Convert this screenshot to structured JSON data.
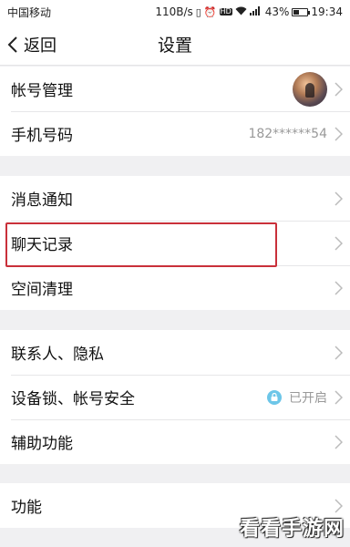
{
  "status_bar": {
    "carrier": "中国移动",
    "speed": "110B/s",
    "signal_label": "4G",
    "battery_percent": "43%",
    "battery_level": 0.43,
    "time": "19:34"
  },
  "nav": {
    "back_label": "返回",
    "title": "设置"
  },
  "groups": [
    {
      "items": [
        {
          "label": "帐号管理",
          "trailing": "avatar"
        },
        {
          "label": "手机号码",
          "value": "182******54"
        }
      ]
    },
    {
      "items": [
        {
          "label": "消息通知"
        },
        {
          "label": "聊天记录",
          "highlighted": true
        },
        {
          "label": "空间清理"
        }
      ]
    },
    {
      "items": [
        {
          "label": "联系人、隐私"
        },
        {
          "label": "设备锁、帐号安全",
          "value": "已开启",
          "icon": "lock-icon"
        },
        {
          "label": "辅助功能"
        }
      ]
    },
    {
      "items": [
        {
          "label": "功能"
        }
      ]
    }
  ],
  "colors": {
    "highlight_border": "#c9303a",
    "lock_badge": "#6dc6e8",
    "value_text": "#999999",
    "page_background": "#f0f0f2"
  },
  "watermark": "看看手游网"
}
